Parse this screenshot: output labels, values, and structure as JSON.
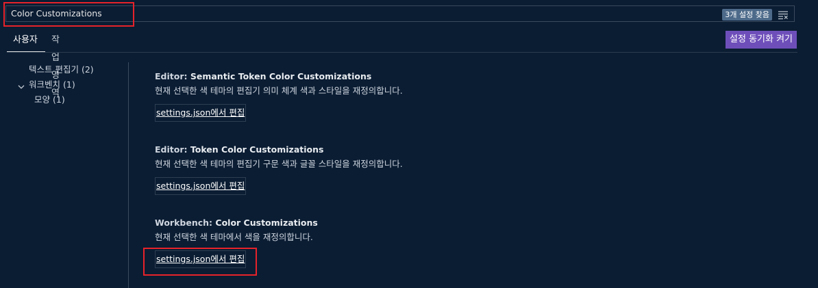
{
  "search": {
    "value": "Color Customizations",
    "result_count": "3개 설정 찾음",
    "filter_icon": "clear-filter-icon"
  },
  "tabs": [
    {
      "label": "사용자",
      "active": true
    },
    {
      "label": "작업 영역",
      "active": false
    }
  ],
  "sync_button_label": "설정 동기화 켜기",
  "sidebar": {
    "items": [
      {
        "label": "텍스트 편집기",
        "count": "(2)"
      },
      {
        "label": "워크벤치",
        "count": "(1)",
        "expanded": true,
        "icon": "chevron-down-icon"
      },
      {
        "label": "모양",
        "count": "(1)"
      }
    ]
  },
  "settings": [
    {
      "category": "Editor: ",
      "name": "Semantic Token Color Customizations",
      "description": "현재 선택한 색 테마의 편집기 의미 체계 색과 스타일을 재정의합니다.",
      "edit_label": "settings.json에서 편집"
    },
    {
      "category": "Editor: ",
      "name": "Token Color Customizations",
      "description": "현재 선택한 색 테마의 편집기 구문 색과 글꼴 스타일을 재정의합니다.",
      "edit_label": "settings.json에서 편집"
    },
    {
      "category": "Workbench: ",
      "name": "Color Customizations",
      "description": "현재 선택한 색 테마에서 색을 재정의합니다.",
      "edit_label": "settings.json에서 편집"
    }
  ],
  "colors": {
    "background": "#0b1d33",
    "highlight": "#e8222a",
    "sync_button": "#6e4fba",
    "badge": "#4d6a8a"
  }
}
